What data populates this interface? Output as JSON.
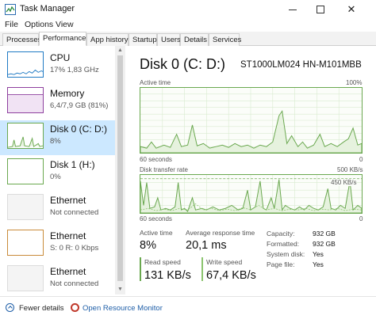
{
  "window": {
    "title": "Task Manager"
  },
  "menu": [
    "File",
    "Options",
    "View"
  ],
  "tabs": [
    "Processes",
    "Performance",
    "App history",
    "Startup",
    "Users",
    "Details",
    "Services"
  ],
  "sidebar": {
    "items": [
      {
        "title": "CPU",
        "subtitle": "17% 1,83 GHz"
      },
      {
        "title": "Memory",
        "subtitle": "6,4/7,9 GB (81%)"
      },
      {
        "title": "Disk 0 (C: D:)",
        "subtitle": "8%"
      },
      {
        "title": "Disk 1 (H:)",
        "subtitle": "0%"
      },
      {
        "title": "Ethernet",
        "subtitle": "Not connected"
      },
      {
        "title": "Ethernet",
        "subtitle": "S: 0 R: 0 Kbps"
      },
      {
        "title": "Ethernet",
        "subtitle": "Not connected"
      }
    ]
  },
  "disk": {
    "heading": "Disk 0 (C: D:)",
    "model": "ST1000LM024 HN-M101MBB",
    "graph1": {
      "label": "Active time",
      "max_label": "100%",
      "time_label": "60 seconds",
      "min_label": "0"
    },
    "graph2": {
      "label": "Disk transfer rate",
      "max_label": "500 KB/s",
      "inner_label": "450 KB/s",
      "time_label": "60 seconds",
      "min_label": "0"
    },
    "stats": {
      "active_time_label": "Active time",
      "active_time_value": "8%",
      "response_label": "Average response time",
      "response_value": "20,1 ms",
      "read_label": "Read speed",
      "read_value": "131 KB/s",
      "write_label": "Write speed",
      "write_value": "67,4 KB/s"
    },
    "info": [
      {
        "key": "Capacity:",
        "value": "932 GB"
      },
      {
        "key": "Formatted:",
        "value": "932 GB"
      },
      {
        "key": "System disk:",
        "value": "Yes"
      },
      {
        "key": "Page file:",
        "value": "Yes"
      }
    ]
  },
  "footer": {
    "fewer_details": "Fewer details",
    "open_monitor": "Open Resource Monitor"
  },
  "colors": {
    "disk_green": "#6aa84f",
    "selected_bg": "#cce8ff",
    "cpu_blue": "#1f7ac4",
    "memory_purple": "#8e3f9e",
    "link_blue": "#1f5fa8"
  }
}
